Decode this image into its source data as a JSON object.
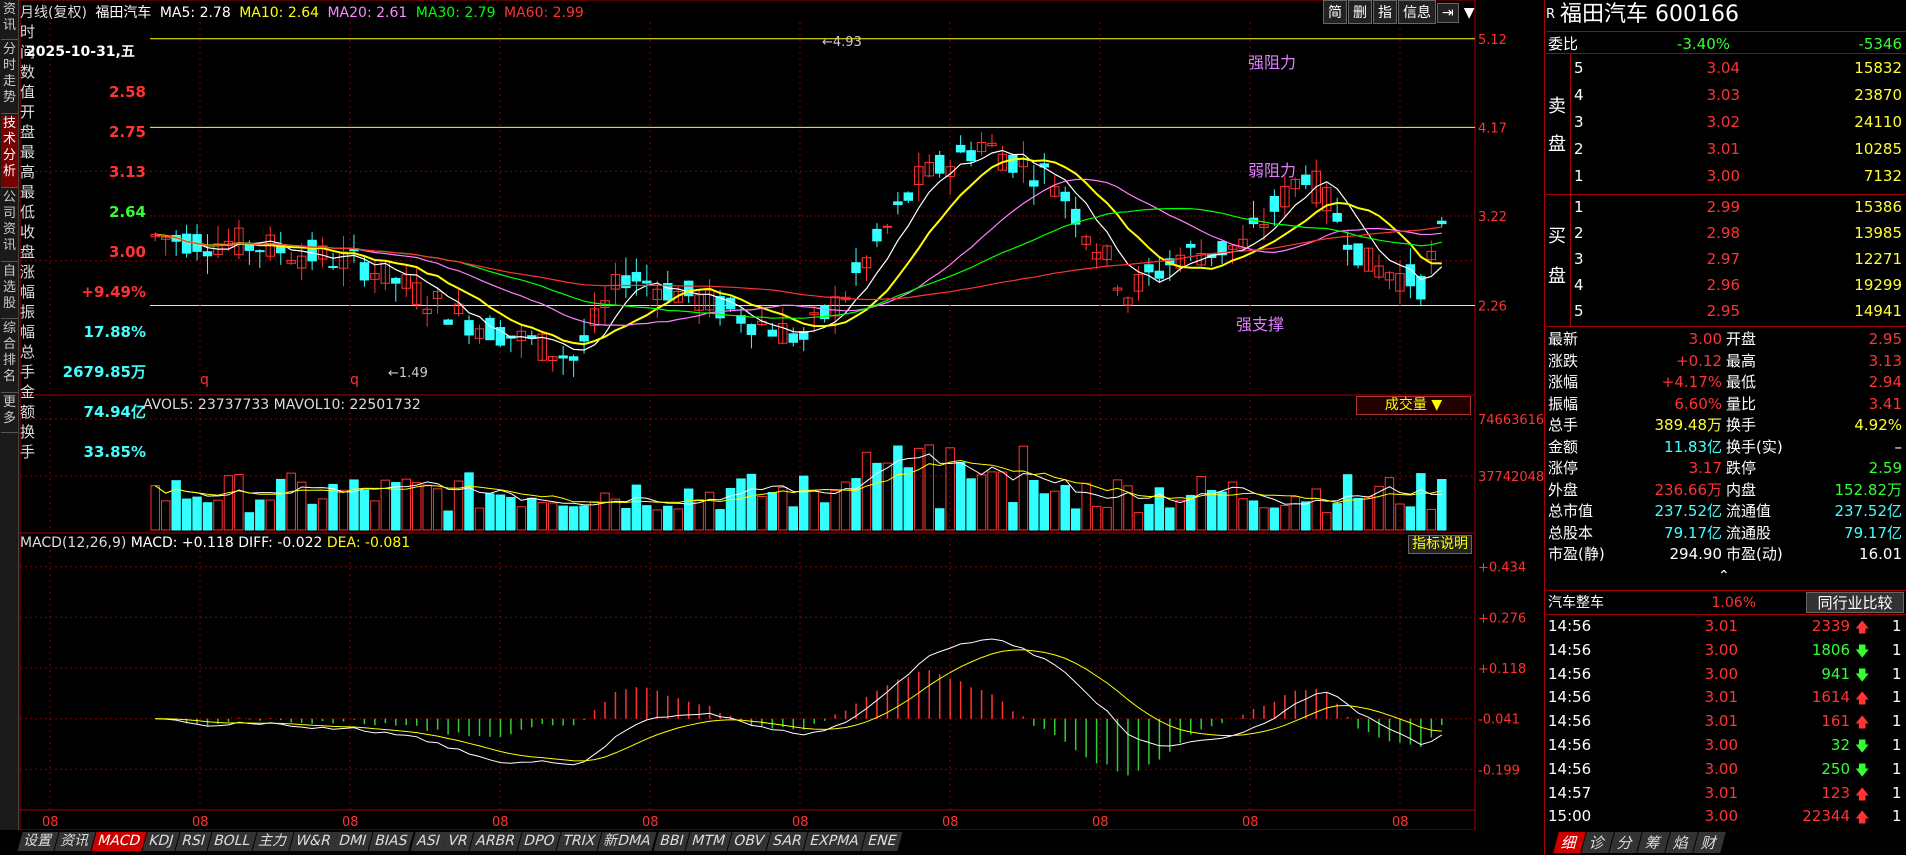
{
  "left_nav": [
    "资讯",
    "分时走势",
    "技术分析",
    "公司资讯",
    "自选股",
    "综合排名",
    "更多"
  ],
  "legend": {
    "period": "月线(复权)",
    "name": "福田汽车",
    "ma5": "MA5: 2.78",
    "ma10": "MA10: 2.64",
    "ma20": "MA20: 2.61",
    "ma30": "MA30: 2.79",
    "ma60": "MA60: 2.99"
  },
  "toolbar": [
    "简",
    "删",
    "指",
    "信息",
    "⇥"
  ],
  "data_window": {
    "time_label": "时间",
    "date": "2025-10-31,五",
    "value_label": "数值",
    "value": "2.58",
    "open_label": "开盘",
    "open": "2.75",
    "high_label": "最高",
    "high": "3.13",
    "low_label": "最低",
    "low": "2.64",
    "close_label": "收盘",
    "close": "3.00",
    "change_label": "涨幅",
    "change": "+9.49%",
    "amp_label": "振幅",
    "amp": "17.88%",
    "vol_label": "总手",
    "vol": "2679.85万",
    "amt_label": "金额",
    "amt": "74.94亿",
    "turn_label": "换手",
    "turn": "33.85%"
  },
  "price_axis": [
    "5.12",
    "4.17",
    "3.22",
    "2.26"
  ],
  "annotations": {
    "strong_res": "强阻力",
    "weak_res": "弱阻力",
    "strong_sup": "强支撑",
    "hi": "4.93",
    "lo": "1.49",
    "q1": "q",
    "q2": "q"
  },
  "vol_legend": {
    "avol5": "AVOL5: 23737733",
    "mavol10": "MAVOL10: 22501732"
  },
  "vol_select": "成交量 ▼",
  "vol_axis": [
    "74663616",
    "37742048"
  ],
  "macd_legend": {
    "name": "MACD(12,26,9)",
    "macd": "MACD: +0.118",
    "diff": "DIFF: -0.022",
    "dea": "DEA: -0.081"
  },
  "indic_btn": "指标说明",
  "macd_axis": [
    "+0.434",
    "+0.276",
    "+0.118",
    "-0.041",
    "-0.199"
  ],
  "x_labels": [
    "08",
    "08",
    "08",
    "08",
    "08",
    "08",
    "08",
    "08",
    "08",
    "08"
  ],
  "bottom_tabs": [
    "设置",
    "资讯",
    "MACD",
    "KDJ",
    "RSI",
    "BOLL",
    "主力",
    "W&R",
    "DMI",
    "BIAS",
    "ASI",
    "VR",
    "ARBR",
    "DPO",
    "TRIX",
    "新DMA",
    "BBI",
    "MTM",
    "OBV",
    "SAR",
    "EXPMA",
    "ENE"
  ],
  "stock": {
    "name": "福田汽车",
    "code": "600166",
    "r": "R"
  },
  "weibi": {
    "label": "委比",
    "pct": "-3.40%",
    "val": "-5346"
  },
  "sell_label": "卖盘",
  "buy_label": "买盘",
  "asks": [
    {
      "lvl": "5",
      "p": "3.04",
      "v": "15832"
    },
    {
      "lvl": "4",
      "p": "3.03",
      "v": "23870"
    },
    {
      "lvl": "3",
      "p": "3.02",
      "v": "24110"
    },
    {
      "lvl": "2",
      "p": "3.01",
      "v": "10285"
    },
    {
      "lvl": "1",
      "p": "3.00",
      "v": "7132"
    }
  ],
  "bids": [
    {
      "lvl": "1",
      "p": "2.99",
      "v": "15386"
    },
    {
      "lvl": "2",
      "p": "2.98",
      "v": "13985"
    },
    {
      "lvl": "3",
      "p": "2.97",
      "v": "12271"
    },
    {
      "lvl": "4",
      "p": "2.96",
      "v": "19299"
    },
    {
      "lvl": "5",
      "p": "2.95",
      "v": "14941"
    }
  ],
  "quote": [
    {
      "l1": "最新",
      "v1": "3.00",
      "c1": "red",
      "l2": "开盘",
      "v2": "2.95",
      "c2": "red"
    },
    {
      "l1": "涨跌",
      "v1": "+0.12",
      "c1": "red",
      "l2": "最高",
      "v2": "3.13",
      "c2": "red"
    },
    {
      "l1": "涨幅",
      "v1": "+4.17%",
      "c1": "red",
      "l2": "最低",
      "v2": "2.94",
      "c2": "red"
    },
    {
      "l1": "振幅",
      "v1": "6.60%",
      "c1": "red",
      "l2": "量比",
      "v2": "3.41",
      "c2": "red"
    },
    {
      "l1": "总手",
      "v1": "389.48万",
      "c1": "yc",
      "l2": "换手",
      "v2": "4.92%",
      "c2": "yc"
    },
    {
      "l1": "金额",
      "v1": "11.83亿",
      "c1": "cyan",
      "l2": "换手(实)",
      "v2": "–",
      "c2": "wh"
    },
    {
      "l1": "涨停",
      "v1": "3.17",
      "c1": "red",
      "l2": "跌停",
      "v2": "2.59",
      "c2": "grn"
    },
    {
      "l1": "外盘",
      "v1": "236.66万",
      "c1": "red",
      "l2": "内盘",
      "v2": "152.82万",
      "c2": "grn"
    },
    {
      "l1": "总市值",
      "v1": "237.52亿",
      "c1": "cyan",
      "l2": "流通值",
      "v2": "237.52亿",
      "c2": "cyan"
    },
    {
      "l1": "总股本",
      "v1": "79.17亿",
      "c1": "cyan",
      "l2": "流通股",
      "v2": "79.17亿",
      "c2": "cyan"
    },
    {
      "l1": "市盈(静)",
      "v1": "294.90",
      "c1": "wh",
      "l2": "市盈(动)",
      "v2": "16.01",
      "c2": "wh"
    }
  ],
  "industry": {
    "name": "汽车整车",
    "pct": "1.06%",
    "btn": "同行业比较"
  },
  "trades": [
    {
      "t": "14:56",
      "p": "3.01",
      "v": "2339",
      "d": "up",
      "n": "1"
    },
    {
      "t": "14:56",
      "p": "3.00",
      "v": "1806",
      "d": "down",
      "n": "1"
    },
    {
      "t": "14:56",
      "p": "3.00",
      "v": "941",
      "d": "down",
      "n": "1"
    },
    {
      "t": "14:56",
      "p": "3.01",
      "v": "1614",
      "d": "up",
      "n": "1"
    },
    {
      "t": "14:56",
      "p": "3.01",
      "v": "161",
      "d": "up",
      "n": "1"
    },
    {
      "t": "14:56",
      "p": "3.00",
      "v": "32",
      "d": "down",
      "n": "1"
    },
    {
      "t": "14:56",
      "p": "3.00",
      "v": "250",
      "d": "down",
      "n": "1"
    },
    {
      "t": "14:57",
      "p": "3.01",
      "v": "123",
      "d": "up",
      "n": "1"
    },
    {
      "t": "15:00",
      "p": "3.00",
      "v": "22344",
      "d": "up",
      "n": "1"
    }
  ],
  "right_tabs": [
    "细",
    "诊",
    "分",
    "筹",
    "焰",
    "财"
  ],
  "colors": {
    "up": "#ff3333",
    "down": "#33ffff",
    "ma5": "#ffffff",
    "ma10": "#ffff00",
    "ma20": "#ff80ff",
    "ma30": "#00ff00",
    "ma60": "#ff3333"
  }
}
